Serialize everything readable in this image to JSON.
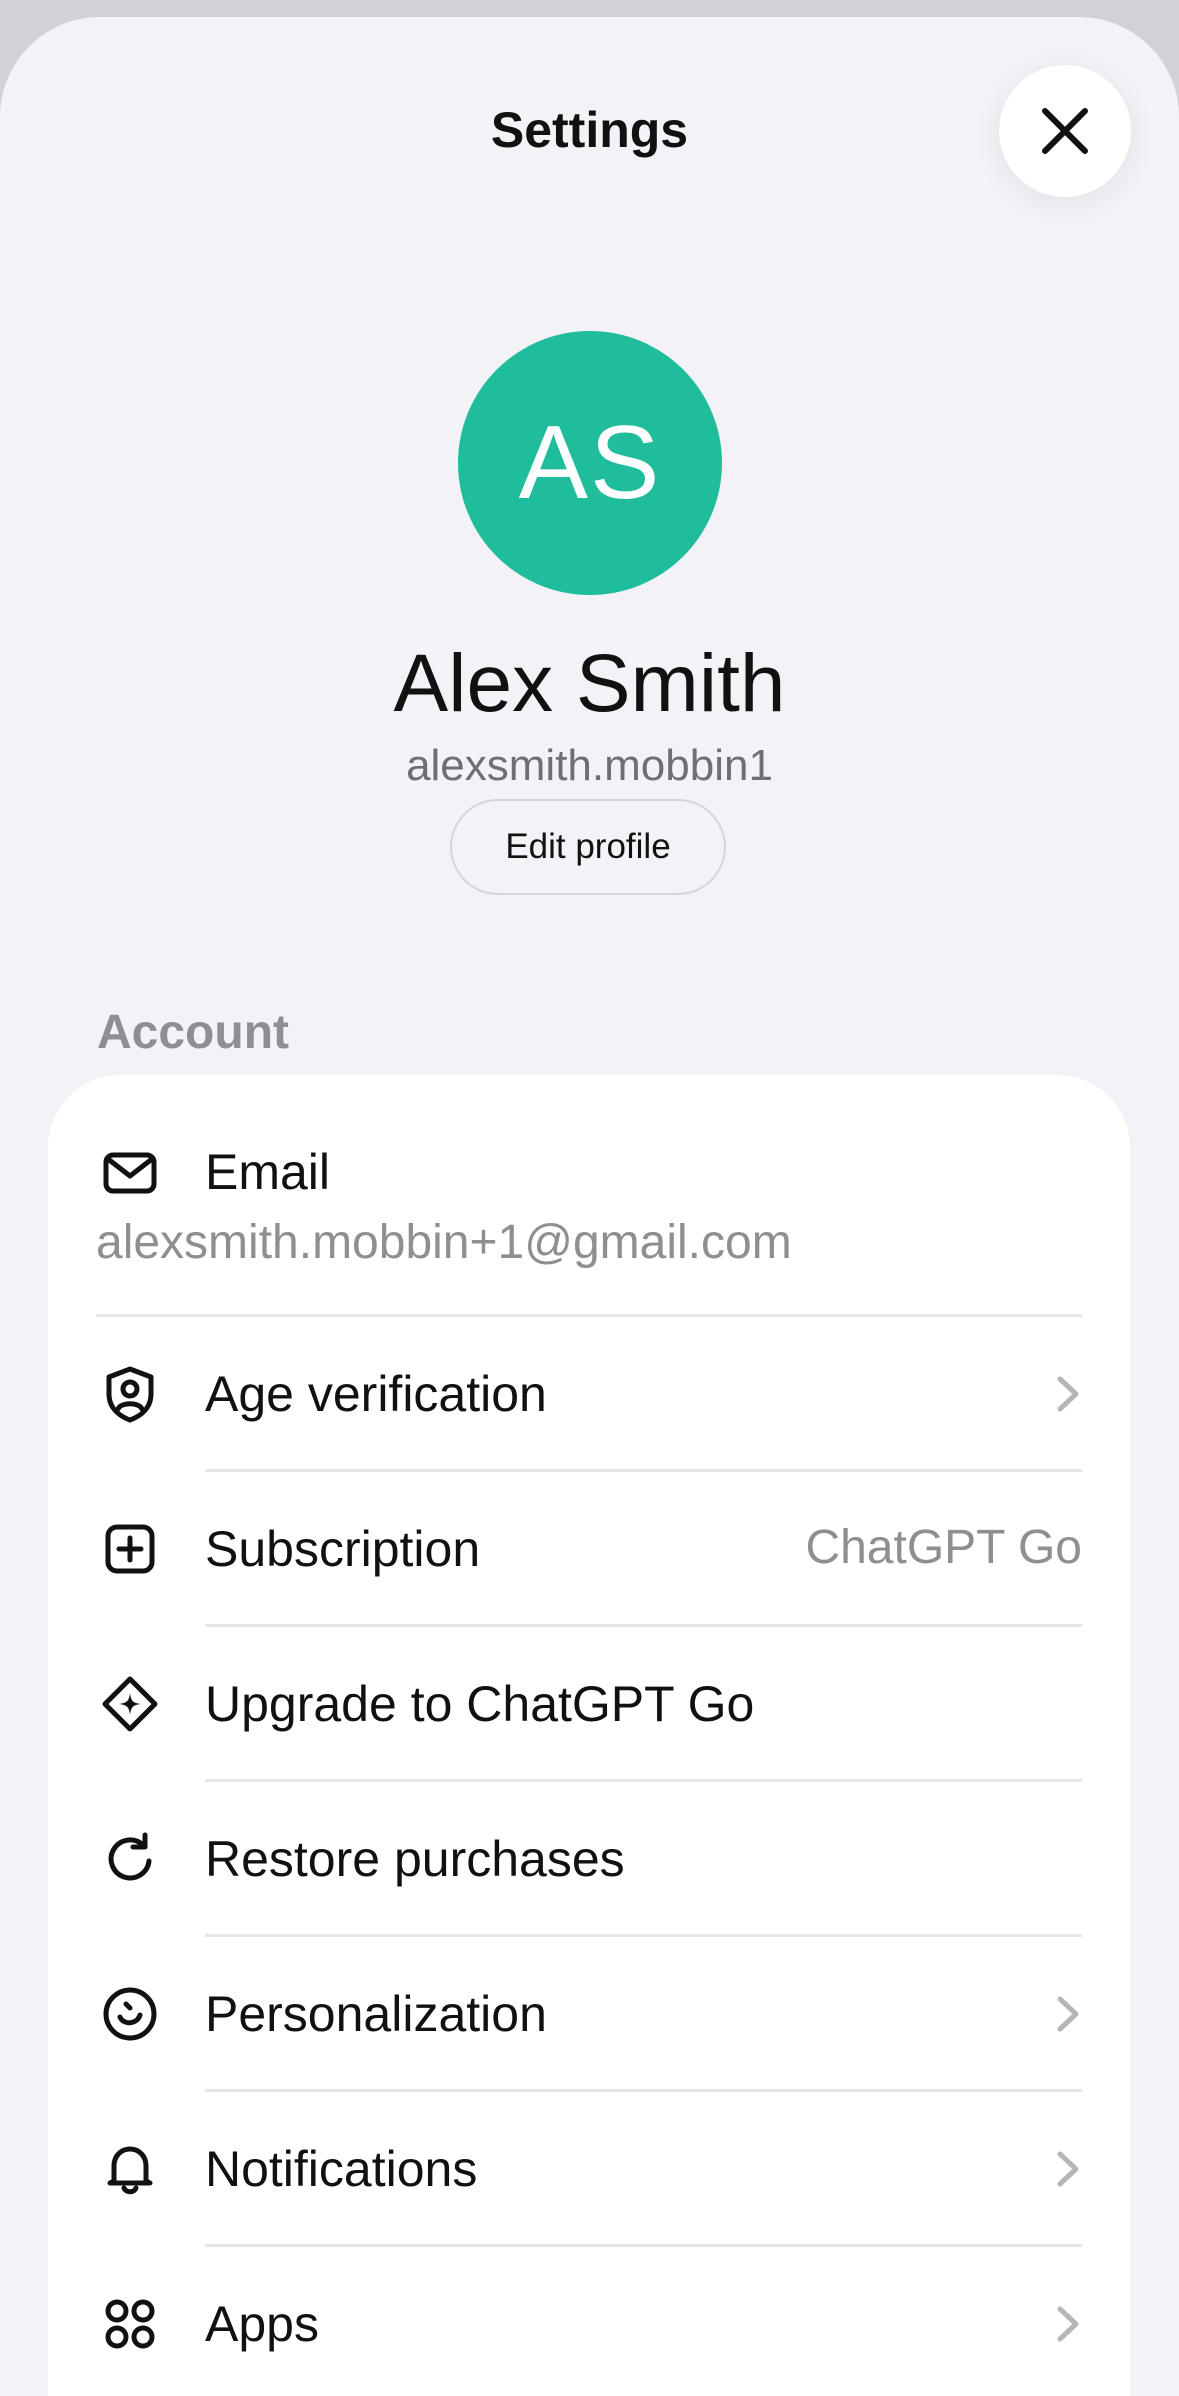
{
  "header": {
    "title": "Settings",
    "close_icon": "close-icon"
  },
  "profile": {
    "initials": "AS",
    "avatar_color": "#1fbd9c",
    "name": "Alex Smith",
    "username": "alexsmith.mobbin1",
    "edit_label": "Edit profile"
  },
  "account": {
    "section_title": "Account",
    "email": {
      "icon": "mail-icon",
      "label": "Email",
      "value": "alexsmith.mobbin+1@gmail.com"
    },
    "rows": [
      {
        "icon": "user-shield-icon",
        "label": "Age verification",
        "value": "",
        "chevron": true
      },
      {
        "icon": "plus-square-icon",
        "label": "Subscription",
        "value": "ChatGPT Go",
        "chevron": false
      },
      {
        "icon": "diamond-sparkle-icon",
        "label": "Upgrade to ChatGPT Go",
        "value": "",
        "chevron": false
      },
      {
        "icon": "refresh-icon",
        "label": "Restore purchases",
        "value": "",
        "chevron": false
      },
      {
        "icon": "smile-icon",
        "label": "Personalization",
        "value": "",
        "chevron": true
      },
      {
        "icon": "bell-icon",
        "label": "Notifications",
        "value": "",
        "chevron": true
      },
      {
        "icon": "apps-grid-icon",
        "label": "Apps",
        "value": "",
        "chevron": true
      }
    ]
  },
  "colors": {
    "background": "#f2f2f7",
    "card": "#ffffff",
    "secondary_text": "#8e8e93",
    "accent": "#1fbd9c"
  }
}
